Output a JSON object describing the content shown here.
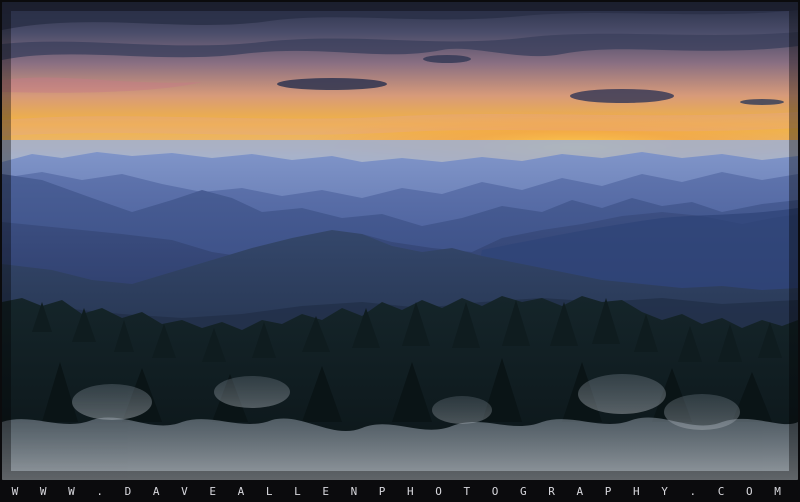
{
  "watermark": {
    "text": "W W W . D A V E A L L E N P H O T O G R A P H Y . C O M"
  },
  "colors": {
    "frame": "#0b0b0d",
    "sky_top": "#2c3550",
    "sunset_glow": "#f4b23a",
    "haze_blue": "#3a4f86",
    "forest_dark": "#132124",
    "frost": "#c9cfd6"
  }
}
